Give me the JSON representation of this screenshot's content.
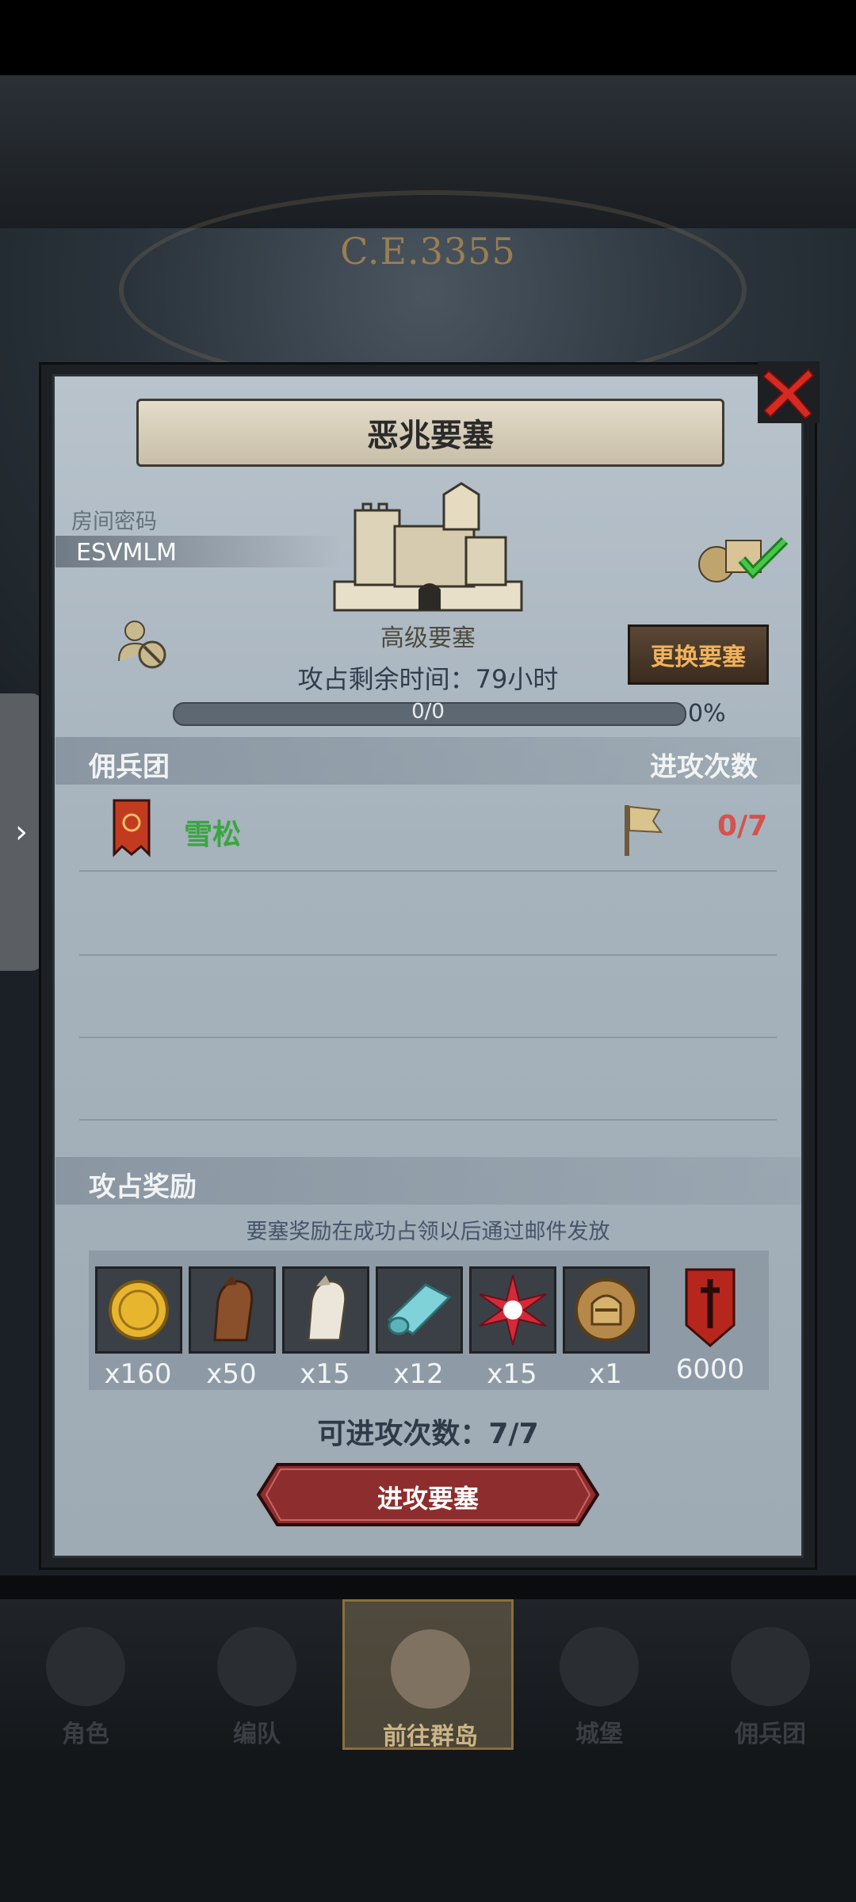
{
  "background": {
    "era_text": "C.E.3355"
  },
  "dialog": {
    "title": "恶兆要塞",
    "room_code_label": "房间密码",
    "room_code": "ESVMLM",
    "fortress_name": "高级要塞",
    "remaining_time": "攻占剩余时间：79小时",
    "change_button": "更换要塞",
    "progress": {
      "text": "0/0",
      "percent_text": "0%",
      "fraction": 0
    },
    "roster_header": {
      "left": "佣兵团",
      "right": "进攻次数"
    },
    "rows": [
      {
        "name": "雪松",
        "count": "0/7"
      }
    ],
    "rewards_header": "攻占奖励",
    "rewards_note": "要塞奖励在成功占领以后通过邮件发放",
    "rewards": [
      {
        "icon": "gold-coin-icon",
        "qty": "x160"
      },
      {
        "icon": "brown-horse-icon",
        "qty": "x50"
      },
      {
        "icon": "white-horse-icon",
        "qty": "x15"
      },
      {
        "icon": "cloth-roll-icon",
        "qty": "x12"
      },
      {
        "icon": "red-star-icon",
        "qty": "x15"
      },
      {
        "icon": "knight-helmet-medal-icon",
        "qty": "x1"
      },
      {
        "icon": "red-sword-banner-icon",
        "qty": "6000"
      }
    ],
    "attack_count": "可进攻次数：7/7",
    "attack_button": "进攻要塞"
  },
  "nav": [
    {
      "label": "角色"
    },
    {
      "label": "编队"
    },
    {
      "label": "前往群岛",
      "active": true
    },
    {
      "label": "城堡"
    },
    {
      "label": "佣兵团"
    }
  ],
  "colors": {
    "accent": "#f1b25a",
    "green": "#3aa640",
    "red": "#d4524f"
  }
}
